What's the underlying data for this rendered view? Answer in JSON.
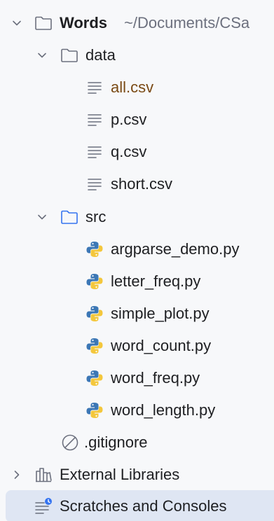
{
  "project": {
    "name": "Words",
    "path": "~/Documents/CSa"
  },
  "data_folder": {
    "name": "data",
    "files": [
      {
        "name": "all.csv",
        "status": "modified"
      },
      {
        "name": "p.csv"
      },
      {
        "name": "q.csv"
      },
      {
        "name": "short.csv"
      }
    ]
  },
  "src_folder": {
    "name": "src",
    "files": [
      {
        "name": "argparse_demo.py"
      },
      {
        "name": "letter_freq.py"
      },
      {
        "name": "simple_plot.py"
      },
      {
        "name": "word_count.py"
      },
      {
        "name": "word_freq.py"
      },
      {
        "name": "word_length.py"
      }
    ]
  },
  "gitignore": {
    "name": ".gitignore"
  },
  "external_libraries": {
    "name": "External Libraries"
  },
  "scratches": {
    "name": "Scratches and Consoles"
  },
  "colors": {
    "background": "#f7f8fa",
    "selection": "#dfe6f3",
    "modified_text": "#7a4a14",
    "folder_src": "#3574f0",
    "python_blue": "#3c77b5",
    "python_yellow": "#f4c73c"
  }
}
